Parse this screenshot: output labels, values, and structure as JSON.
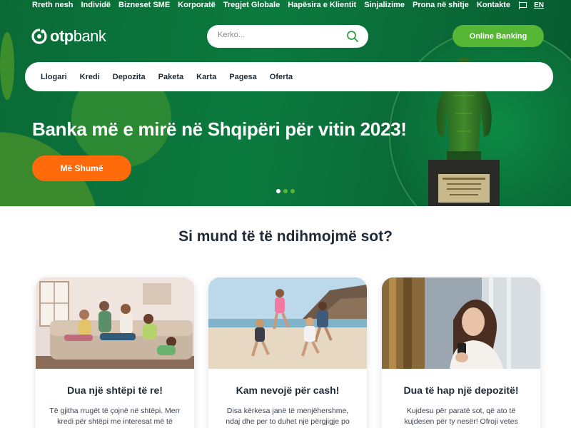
{
  "top_nav": [
    "Rreth nesh",
    "Individë",
    "Bizneset SME",
    "Korporatë",
    "Tregjet Globale",
    "Hapësira e Klientit",
    "Sinjalizime",
    "Prona në shitje",
    "Kontakte"
  ],
  "language": "EN",
  "logo": {
    "prefix": "otp",
    "suffix": "bank"
  },
  "search": {
    "placeholder": "Kerko..."
  },
  "online_banking_label": "Online Banking",
  "main_nav": [
    "Llogari",
    "Kredi",
    "Depozita",
    "Paketa",
    "Karta",
    "Pagesa",
    "Oferta"
  ],
  "hero": {
    "headline": "Banka më e mirë në Shqipëri për vitin 2023!",
    "cta_label": "Më Shumë",
    "slides": 3,
    "active_slide": 1
  },
  "section_title": "Si mund të të ndihmojmë sot?",
  "cards": [
    {
      "title": "Dua një shtëpi të re!",
      "text": "Të gjitha rrugët të çojnë në shtëpi. Merr kredi për shtëpi me interesat më të"
    },
    {
      "title": "Kam nevojë për cash!",
      "text": "Disa kërkesa janë të menjëhershme, ndaj dhe per to duhet një përgjigje po"
    },
    {
      "title": "Dua të hap një depozitë!",
      "text": "Kujdesu për paratë sot, që ato të kujdesen për ty nesër! Ofroji vetes"
    }
  ],
  "colors": {
    "brand_green": "#0a7a3e",
    "accent_green": "#56b735",
    "cta_orange": "#ff6b0a"
  }
}
